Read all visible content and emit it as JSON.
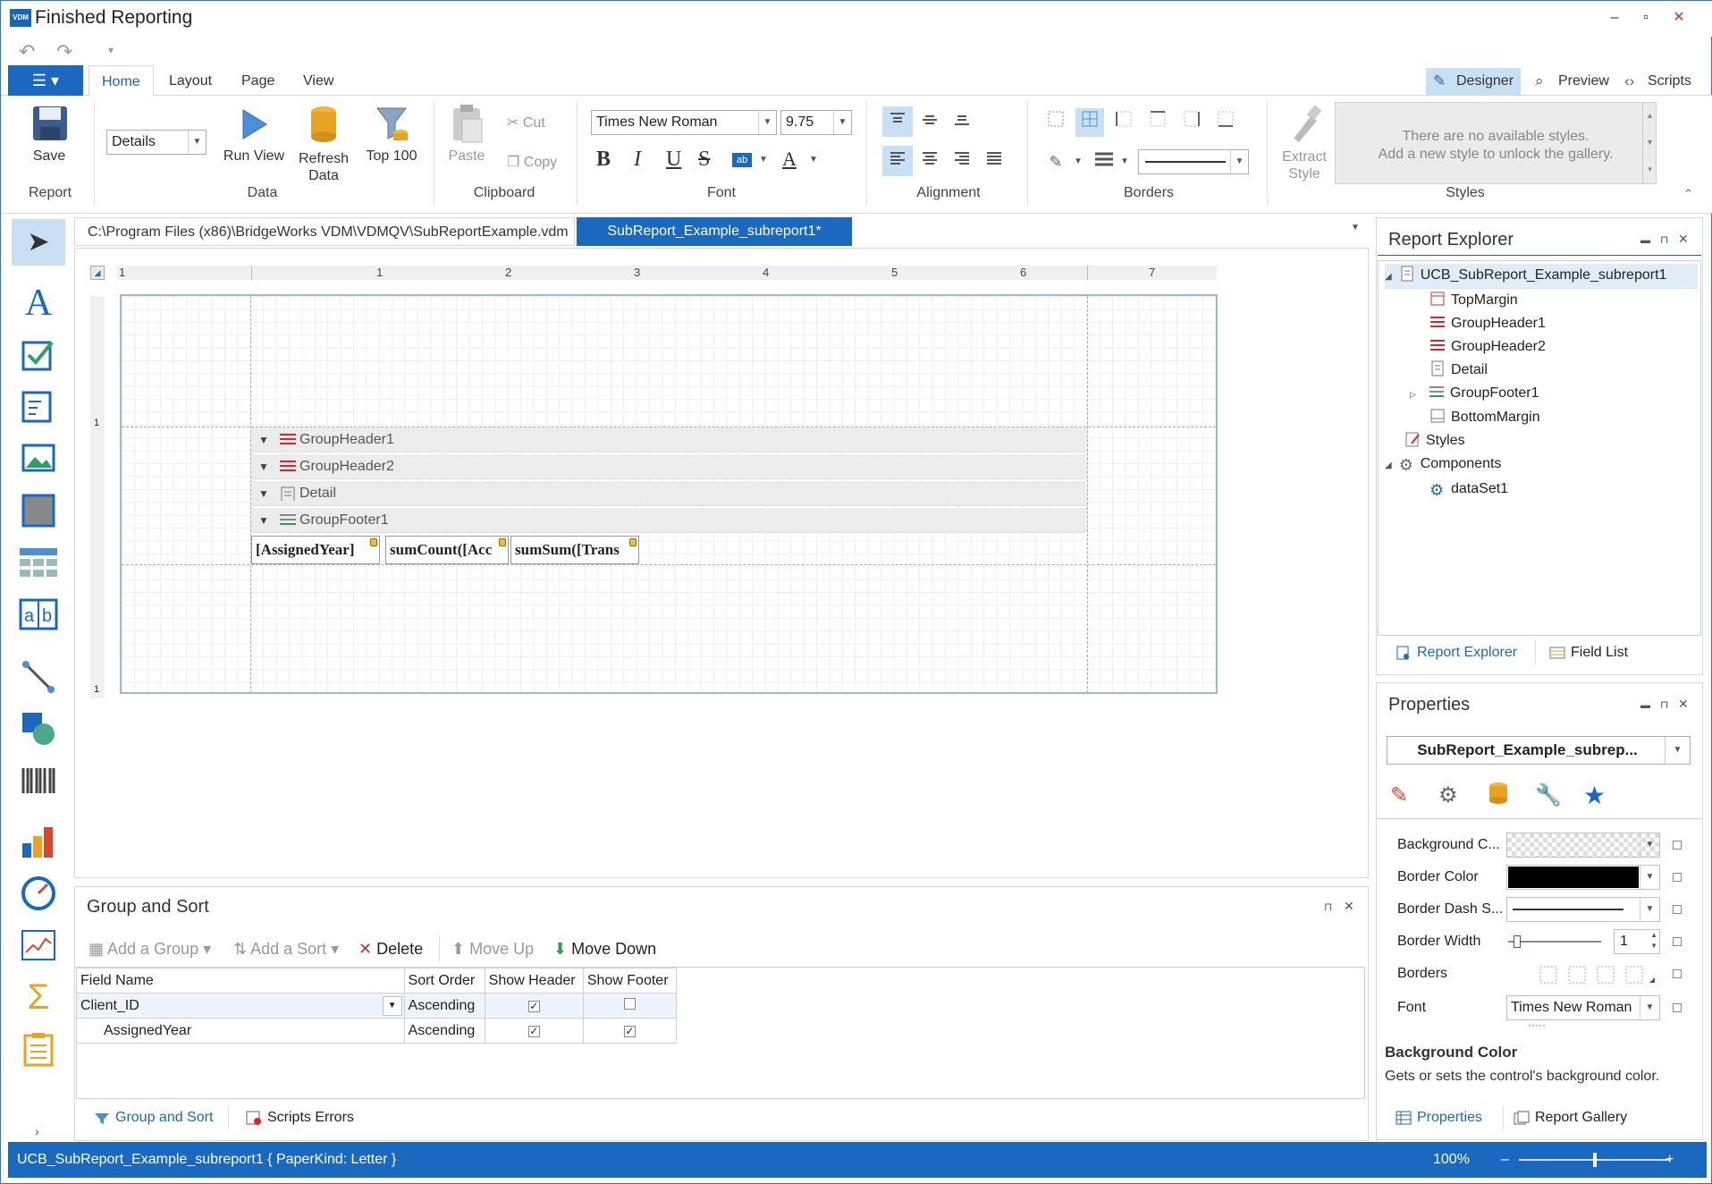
{
  "window": {
    "title": "Finished Reporting",
    "logo": "VDM",
    "minimize": "–",
    "maximize": "▫",
    "close": "✕",
    "close_color": "#c0392b"
  },
  "quick_access": {
    "undo": "↶",
    "redo": "↷",
    "customize": "▾"
  },
  "ribbon": {
    "file_icon": "☰ ▾",
    "tabs": [
      "Home",
      "Layout",
      "Page",
      "View"
    ],
    "active_tab": "Home",
    "modes": [
      {
        "label": "Designer",
        "icon": "designer-icon",
        "glyph": "✎"
      },
      {
        "label": "Preview",
        "icon": "preview-icon",
        "glyph": "⌕"
      },
      {
        "label": "Scripts",
        "icon": "scripts-icon",
        "glyph": "‹›"
      }
    ],
    "groups": {
      "report": "Report",
      "data": "Data",
      "clipboard": "Clipboard",
      "font": "Font",
      "alignment": "Alignment",
      "borders": "Borders",
      "styles": "Styles"
    },
    "save": "Save",
    "band_select": "Details",
    "run_view": "Run View",
    "refresh": "Refresh Data",
    "top100": "Top 100",
    "paste": "Paste",
    "cut": "Cut",
    "copy": "Copy",
    "font_family": "Times New Roman",
    "font_size": "9.75",
    "bold": "B",
    "italic": "I",
    "underline": "U",
    "strike": "S",
    "highlight": "ab",
    "fontcolor": "A",
    "extract_style": "Extract Style",
    "styles_empty_1": "There are no available styles.",
    "styles_empty_2": "Add a new style to unlock the gallery."
  },
  "doc_tabs": [
    "C:\\Program Files (x86)\\BridgeWorks VDM\\VDMQV\\SubReportExample.vdm",
    "SubReport_Example_subreport1*"
  ],
  "ruler": [
    "1",
    "1",
    "2",
    "3",
    "4",
    "5",
    "6",
    "7"
  ],
  "vruler": [
    "1",
    "1"
  ],
  "bands": [
    "GroupHeader1",
    "GroupHeader2",
    "Detail",
    "GroupFooter1"
  ],
  "cells": [
    "[AssignedYear]",
    "sumCount([Acc",
    "sumSum([Trans"
  ],
  "group_sort": {
    "title": "Group and Sort",
    "add_group": "Add a Group",
    "add_sort": "Add a Sort",
    "delete": "Delete",
    "move_up": "Move Up",
    "move_down": "Move Down",
    "columns": [
      "Field Name",
      "Sort Order",
      "Show Header",
      "Show Footer"
    ],
    "rows": [
      {
        "field": "Client_ID",
        "order": "Ascending",
        "header": "✓",
        "footer": ""
      },
      {
        "field": "AssignedYear",
        "order": "Ascending",
        "header": "✓",
        "footer": "✓"
      }
    ],
    "bottom_tabs": [
      "Group and Sort",
      "Scripts Errors"
    ]
  },
  "report_explorer": {
    "title": "Report Explorer",
    "items": [
      "UCB_SubReport_Example_subreport1",
      "TopMargin",
      "GroupHeader1",
      "GroupHeader2",
      "Detail",
      "GroupFooter1",
      "BottomMargin",
      "Styles",
      "Components",
      "dataSet1"
    ],
    "bottom_tabs": [
      "Report Explorer",
      "Field List"
    ]
  },
  "properties": {
    "title": "Properties",
    "selected": "SubReport_Example_subrep...",
    "rows": [
      {
        "label": "Background C...",
        "value": ""
      },
      {
        "label": "Border Color",
        "value": ""
      },
      {
        "label": "Border Dash S...",
        "value": ""
      },
      {
        "label": "Border Width",
        "value": "1"
      },
      {
        "label": "Borders",
        "value": ""
      },
      {
        "label": "Font",
        "value": "Times New Roman"
      }
    ],
    "desc_title": "Background Color",
    "desc_text": "Gets or sets the control's background color.",
    "dots": "·····",
    "bottom_tabs": [
      "Properties",
      "Report Gallery"
    ]
  },
  "status": {
    "text": "UCB_SubReport_Example_subreport1 { PaperKind: Letter }",
    "zoom": "100%",
    "zoom_slider": 0.5,
    "minus": "–",
    "plus": "+"
  },
  "colors": {
    "accent": "#1a68c0",
    "border_color_swatch": "#000000"
  }
}
